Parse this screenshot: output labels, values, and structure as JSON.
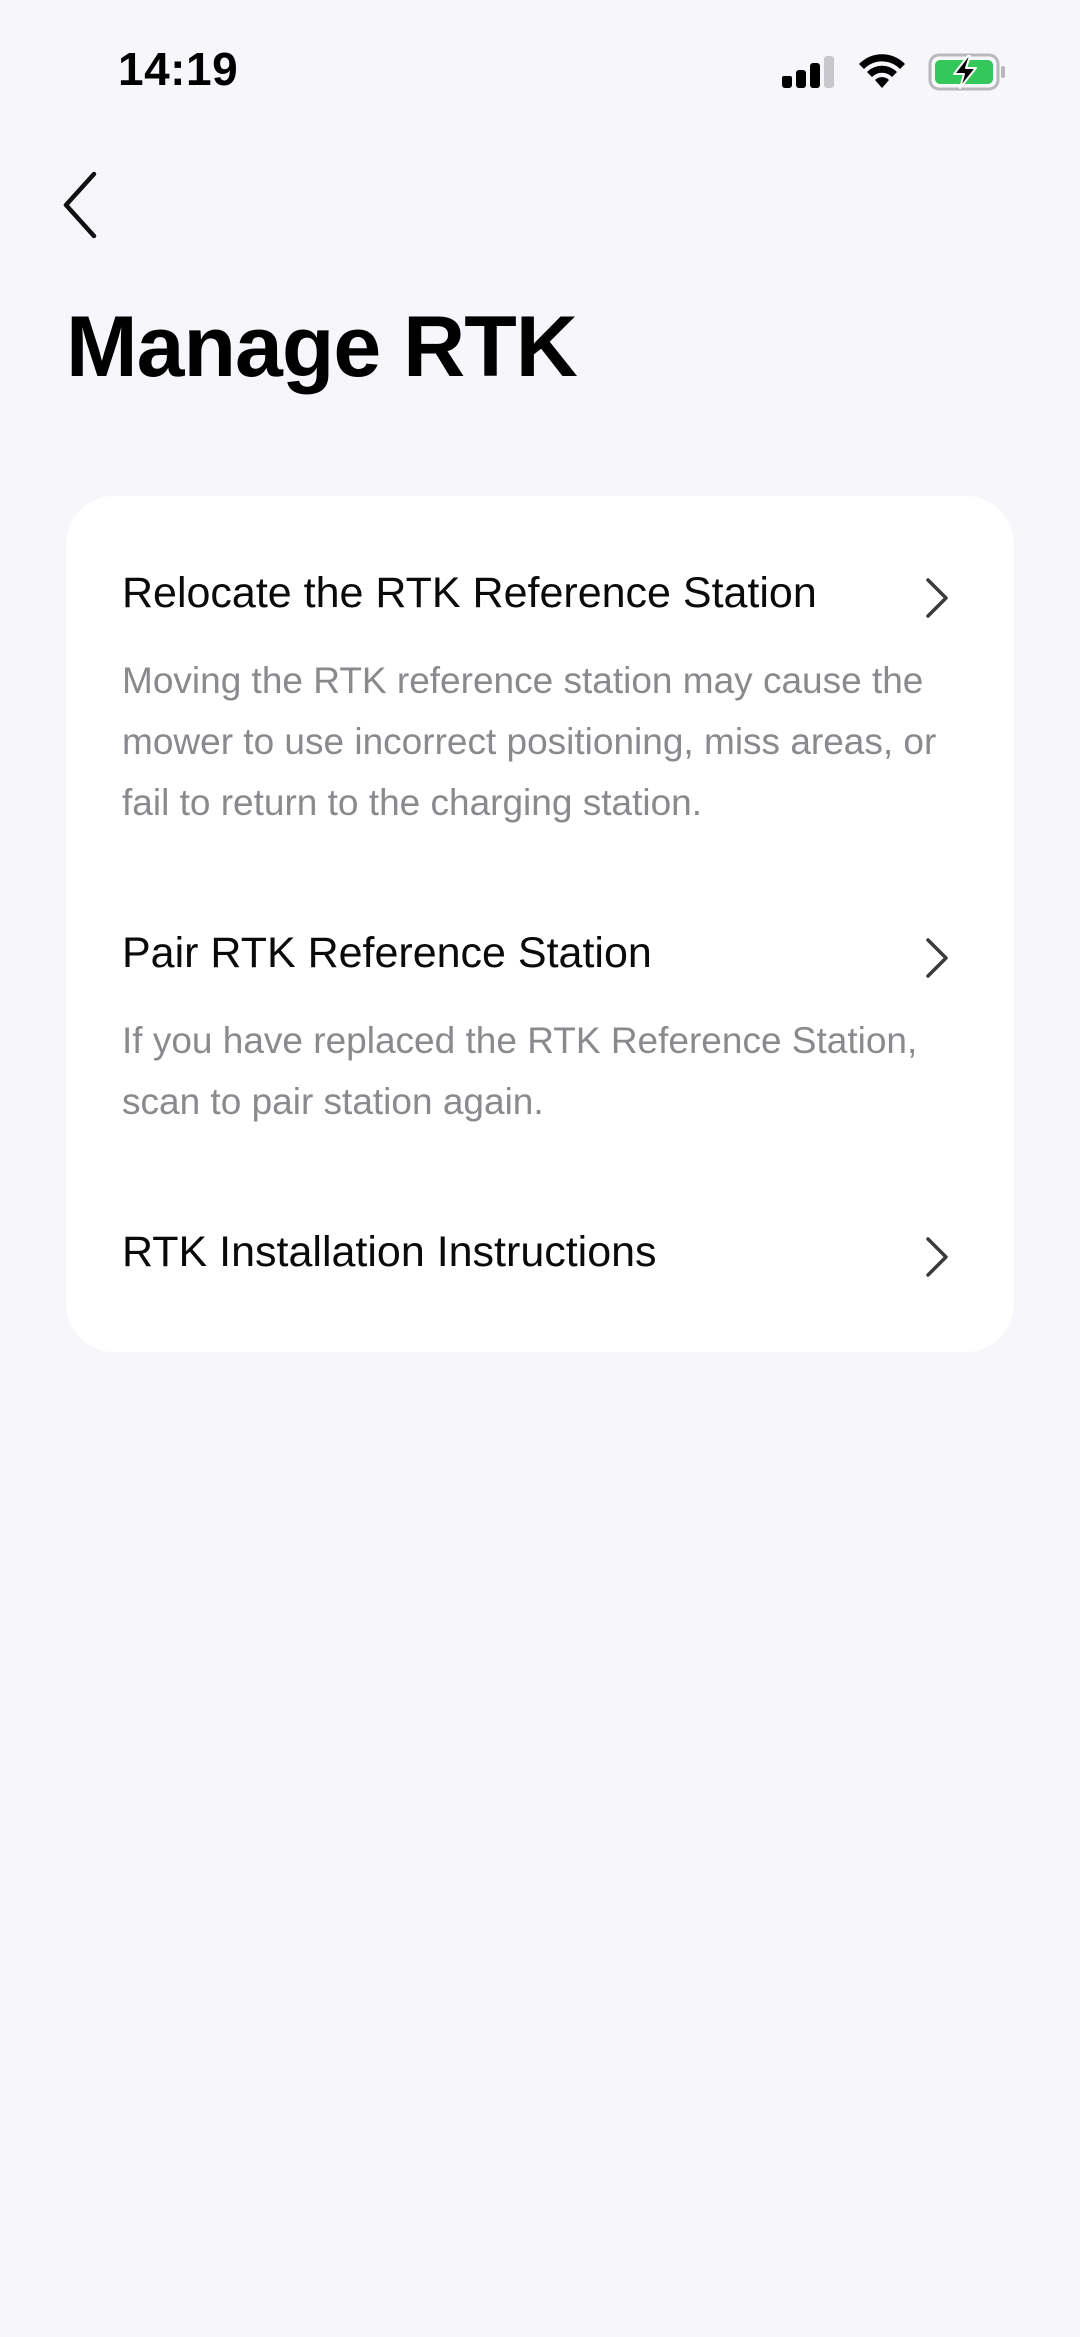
{
  "status_bar": {
    "time": "14:19",
    "icons": [
      "cellular-signal-icon",
      "wifi-icon",
      "battery-charging-icon"
    ],
    "battery_color": "#34c759"
  },
  "header": {
    "back_icon": "chevron-left-icon",
    "title": "Manage RTK"
  },
  "menu": {
    "items": [
      {
        "title": "Relocate the RTK Reference Station",
        "description": "Moving the RTK reference station may cause the mower to use incorrect positioning, miss areas, or fail to return to the charging station.",
        "icon": "chevron-right-icon"
      },
      {
        "title": "Pair RTK Reference Station",
        "description": "If you have replaced the RTK Reference Station, scan to pair station again.",
        "icon": "chevron-right-icon"
      },
      {
        "title": "RTK Installation Instructions",
        "icon": "chevron-right-icon"
      }
    ]
  },
  "colors": {
    "background": "#f7f7fb",
    "card": "#ffffff",
    "primary_text": "#0a0a0a",
    "secondary_text": "#8a8a8e"
  }
}
